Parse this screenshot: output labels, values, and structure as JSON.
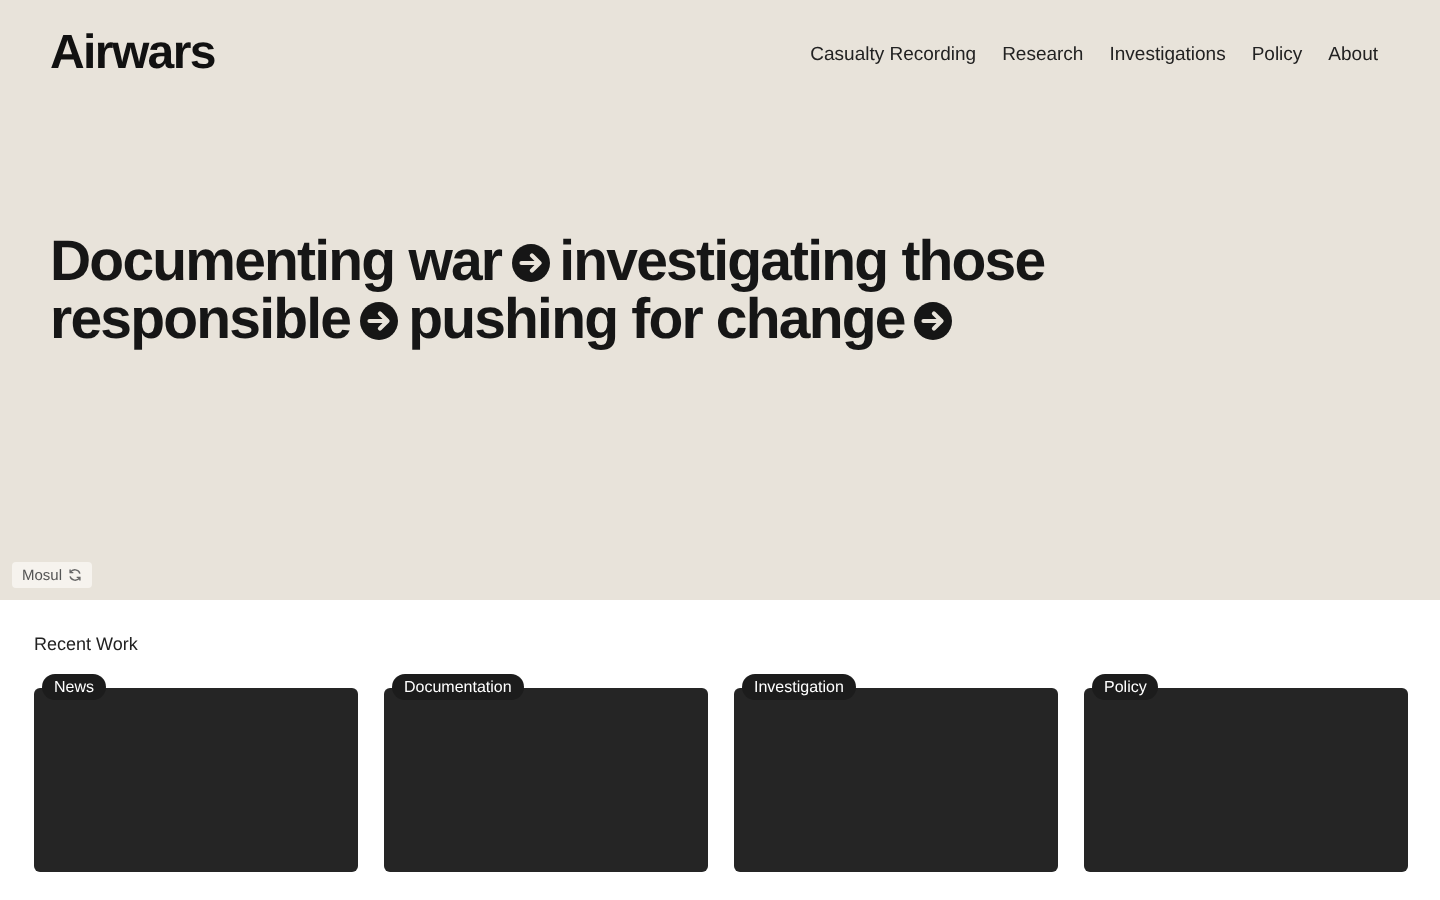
{
  "logo": "Airwars",
  "nav": [
    "Casualty Recording",
    "Research",
    "Investigations",
    "Policy",
    "About"
  ],
  "hero": {
    "phrases": [
      "Documenting war",
      "investigating those",
      "responsible",
      "pushing for change"
    ],
    "caption": "Mosul"
  },
  "recent": {
    "title": "Recent Work",
    "cards": [
      {
        "tag": "News"
      },
      {
        "tag": "Documentation"
      },
      {
        "tag": "Investigation"
      },
      {
        "tag": "Policy"
      }
    ]
  }
}
